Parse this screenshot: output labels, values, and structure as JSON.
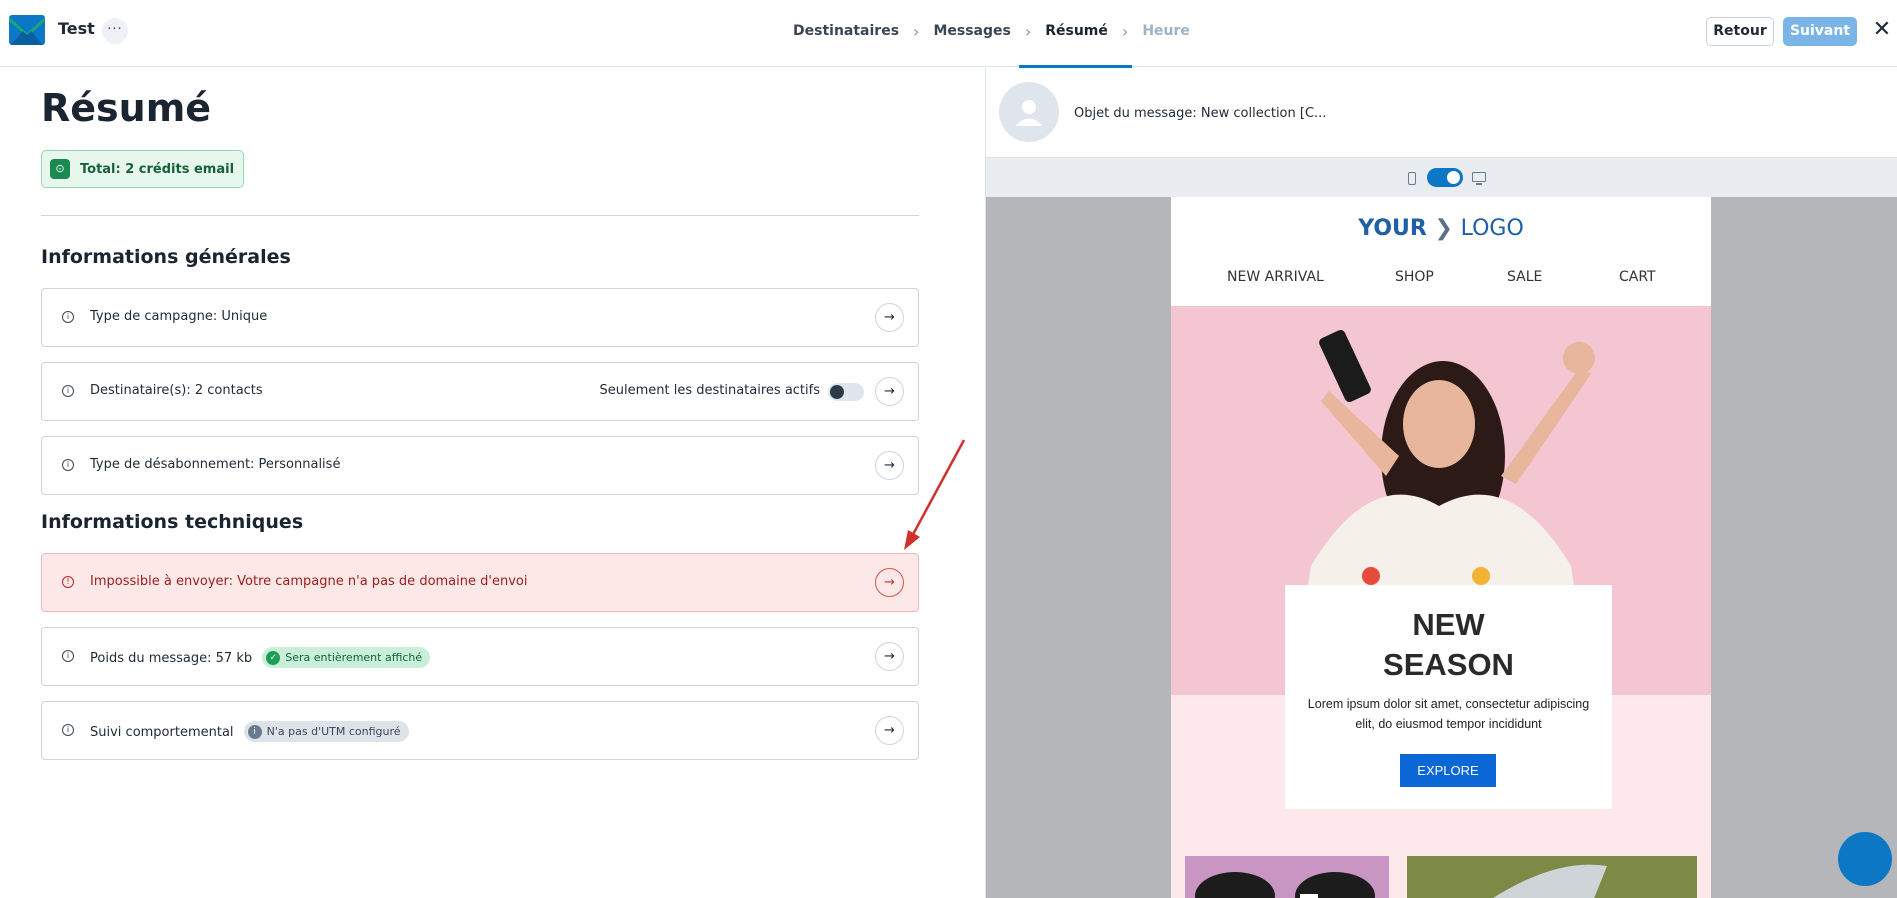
{
  "header": {
    "app_title": "Test",
    "more_label": "···",
    "steps": [
      {
        "label": "Destinataires",
        "state": "done"
      },
      {
        "label": "Messages",
        "state": "done"
      },
      {
        "label": "Résumé",
        "state": "active"
      },
      {
        "label": "Heure",
        "state": "disabled"
      }
    ],
    "step_separator": "›",
    "back_label": "Retour",
    "next_label": "Suivant",
    "close_label": "✕"
  },
  "summary": {
    "title": "Résumé",
    "credits_label": "Total: 2 crédits email",
    "general_title": "Informations générales",
    "general_rows": [
      {
        "text": "Type de campagne: Unique"
      },
      {
        "text": "Destinataire(s): 2 contacts",
        "toggle_label": "Seulement les destinataires actifs",
        "toggle_on": false
      },
      {
        "text": "Type de désabonnement: Personnalisé"
      }
    ],
    "technical_title": "Informations techniques",
    "technical_rows": [
      {
        "text": "Impossible à envoyer: Votre campagne n'a pas de domaine d'envoi",
        "status": "error"
      },
      {
        "text": "Poids du message: 57 kb",
        "pill": "Sera entièrement affiché",
        "pill_status": "success"
      },
      {
        "text": "Suivi comportemental",
        "pill": "N'a pas d'UTM configuré",
        "pill_status": "neutral"
      }
    ],
    "row_icon": "info-circle-icon",
    "row_action_icon": "arrow-right-icon",
    "arrow_glyph": "→"
  },
  "preview": {
    "subject_label": "Objet du message: New collection [C...",
    "device_mode": "desktop",
    "email": {
      "logo_left": "YOUR",
      "logo_right": "LOGO",
      "nav": [
        "NEW ARRIVAL",
        "SHOP",
        "SALE",
        "CART"
      ],
      "headline_line1": "NEW",
      "headline_line2": "SEASON",
      "body": "Lorem ipsum dolor sit amet, consectetur adipiscing elit, do eiusmod tempor incididunt",
      "cta": "EXPLORE"
    }
  },
  "colors": {
    "accent": "#0b77c5",
    "success": "#1f9d55",
    "error": "#b3261e",
    "error_bg": "#fde8e8",
    "annotation_arrow": "#d0312d"
  }
}
